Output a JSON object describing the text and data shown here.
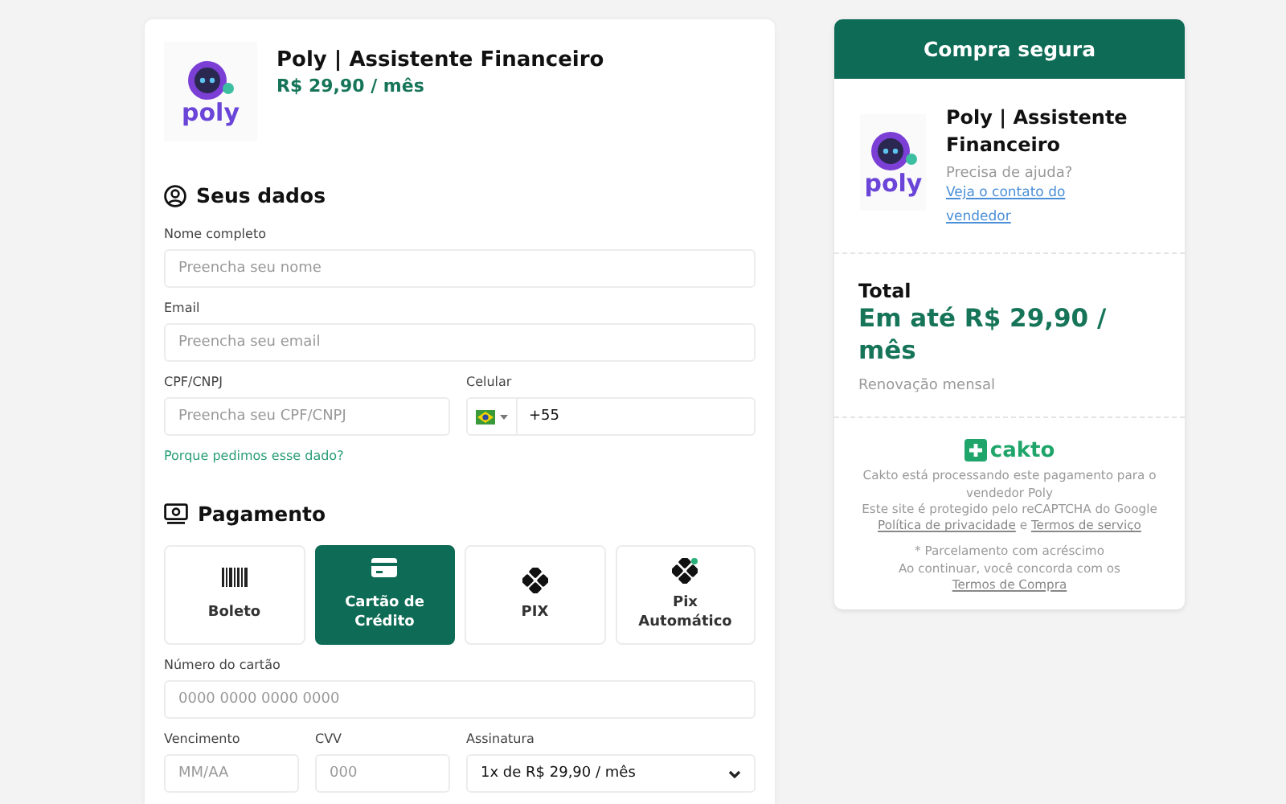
{
  "product": {
    "logo_text": "poly",
    "name": "Poly | Assistente Financeiro",
    "price": "R$ 29,90 / mês"
  },
  "personal": {
    "title": "Seus dados",
    "rows": [
      [
        {
          "kind": "text",
          "label": "Nome completo",
          "placeholder": "Preencha seu nome"
        }
      ],
      [
        {
          "kind": "text",
          "label": "Email",
          "placeholder": "Preencha seu email"
        }
      ],
      [
        {
          "kind": "text",
          "label": "CPF/CNPJ",
          "placeholder": "Preencha seu CPF/CNPJ"
        },
        {
          "kind": "phone",
          "label": "Celular",
          "value": "+55"
        }
      ]
    ],
    "link": "Porque pedimos esse dado?"
  },
  "payment": {
    "title": "Pagamento",
    "methods": [
      {
        "kind": "barcode",
        "label": "Boleto",
        "selected": false
      },
      {
        "kind": "card",
        "label": "Cartão de Crédito",
        "selected": true
      },
      {
        "kind": "pix",
        "label": "PIX",
        "selected": false
      },
      {
        "kind": "pix-auto",
        "label": "Pix Automático",
        "selected": false
      }
    ],
    "rows": [
      [
        {
          "kind": "text",
          "label": "Número do cartão",
          "placeholder": "0000 0000 0000 0000"
        }
      ],
      [
        {
          "kind": "text",
          "label": "Vencimento",
          "placeholder": "MM/AA"
        },
        {
          "kind": "text",
          "label": "CVV",
          "placeholder": "000"
        },
        {
          "kind": "select",
          "label": "Assinatura",
          "value": "1x de R$ 29,90 / mês"
        }
      ]
    ]
  },
  "summary": {
    "header": "Compra segura",
    "logo_text": "poly",
    "name": "Poly | Assistente Financeiro",
    "help": "Precisa de ajuda?",
    "contact_link": "Veja o contato do vendedor",
    "total_label": "Total",
    "total_value": "Em até R$ 29,90 / mês",
    "renewal": "Renovação mensal",
    "brand": "cakto",
    "processing": "Cakto está processando este pagamento para o vendedor Poly",
    "recaptcha": "Este site é protegido pelo reCAPTCHA do Google",
    "privacy_link": "Política de privacidade",
    "conjunction": "e",
    "terms_link": "Termos de serviço",
    "installments": "* Parcelamento com acréscimo",
    "agree": "Ao continuar, você concorda com os",
    "purchase_terms_link": "Termos de Compra"
  }
}
